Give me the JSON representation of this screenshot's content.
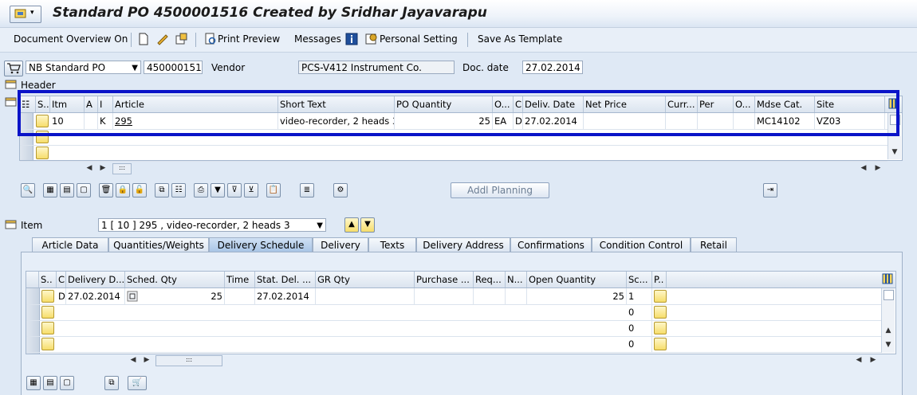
{
  "title": "Standard PO 4500001516 Created by Sridhar Jayavarapu",
  "toolbar": {
    "document_overview": "Document Overview On",
    "print_preview": "Print Preview",
    "messages": "Messages",
    "personal_setting": "Personal Setting",
    "save_as_template": "Save As Template"
  },
  "header_bar": {
    "po_type": "NB Standard PO",
    "po_number": "4500001516",
    "vendor_label": "Vendor",
    "vendor_value": "PCS-V412 Instrument Co.",
    "doc_date_label": "Doc. date",
    "doc_date_value": "27.02.2014",
    "header_label": "Header"
  },
  "item_table": {
    "columns": [
      "S..",
      "Itm",
      "A",
      "I",
      "Article",
      "Short Text",
      "PO Quantity",
      "O...",
      "C",
      "Deliv. Date",
      "Net Price",
      "Curr...",
      "Per",
      "O...",
      "Mdse Cat.",
      "Site"
    ],
    "rows": [
      {
        "itm": "10",
        "a": "",
        "i": "K",
        "article": "295",
        "short_text": "video-recorder, 2 heads 3",
        "po_qty": "25",
        "unit": "EA",
        "c": "D",
        "deliv_date": "27.02.2014",
        "net_price": "",
        "curr": "",
        "per": "",
        "o": "",
        "mdse_cat": "MC14102",
        "site": "VZ03"
      }
    ]
  },
  "buttons": {
    "addl_planning": "Addl Planning"
  },
  "item_section": {
    "label": "Item",
    "selected_item": "1 [ 10 ] 295 , video-recorder, 2 heads 3"
  },
  "tabs": [
    "Article Data",
    "Quantities/Weights",
    "Delivery Schedule",
    "Delivery",
    "Texts",
    "Delivery Address",
    "Confirmations",
    "Condition Control",
    "Retail"
  ],
  "active_tab": "Delivery Schedule",
  "schedule_table": {
    "columns": [
      "S..",
      "C",
      "Delivery D...",
      "Sched. Qty",
      "Time",
      "Stat. Del. ...",
      "GR Qty",
      "Purchase ...",
      "Req...",
      "N...",
      "Open Quantity",
      "Sc...",
      "P.."
    ],
    "rows": [
      {
        "c": "D",
        "delivery_date": "27.02.2014",
        "sched_qty": "25",
        "time": "",
        "stat_del": "27.02.2014",
        "open_qty": "25",
        "sc": "1"
      },
      {
        "c": "",
        "delivery_date": "",
        "sched_qty": "",
        "time": "",
        "stat_del": "",
        "open_qty": "",
        "sc": "0"
      },
      {
        "c": "",
        "delivery_date": "",
        "sched_qty": "",
        "time": "",
        "stat_del": "",
        "open_qty": "",
        "sc": "0"
      },
      {
        "c": "",
        "delivery_date": "",
        "sched_qty": "",
        "time": "",
        "stat_del": "",
        "open_qty": "",
        "sc": "0"
      }
    ]
  },
  "colors": {
    "highlight": "#0a14c8",
    "background": "#dfe9f5"
  }
}
